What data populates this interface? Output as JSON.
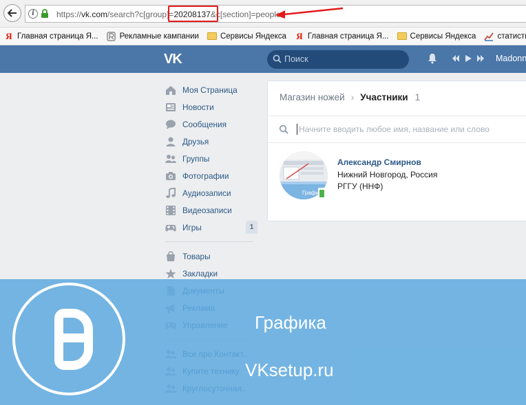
{
  "browser": {
    "url_prefix": "https://",
    "url_domain": "vk.com",
    "url_path_before": "/search?c[group]=",
    "url_highlight": "20208137",
    "url_path_after": "&c[section]=people"
  },
  "bookmarks": [
    {
      "label": "Главная страница Я...",
      "icon": "yandex-icon"
    },
    {
      "label": "Рекламные кампании",
      "icon": "ads-icon"
    },
    {
      "label": "Сервисы Яндекса",
      "icon": "folder-icon"
    },
    {
      "label": "Главная страница Я...",
      "icon": "yandex-icon"
    },
    {
      "label": "Сервисы Яндекса",
      "icon": "folder-icon"
    },
    {
      "label": "статистика сайт",
      "icon": "chart-icon"
    }
  ],
  "header": {
    "logo": "VK",
    "search_placeholder": "Поиск",
    "user_name": "Madonna"
  },
  "sidebar": {
    "items": [
      {
        "label": "Моя Страница",
        "icon": "home-icon"
      },
      {
        "label": "Новости",
        "icon": "news-icon"
      },
      {
        "label": "Сообщения",
        "icon": "messages-icon"
      },
      {
        "label": "Друзья",
        "icon": "friend-icon"
      },
      {
        "label": "Группы",
        "icon": "groups-icon"
      },
      {
        "label": "Фотографии",
        "icon": "camera-icon"
      },
      {
        "label": "Аудиозаписи",
        "icon": "music-icon"
      },
      {
        "label": "Видеозаписи",
        "icon": "video-icon"
      },
      {
        "label": "Игры",
        "icon": "gamepad-icon",
        "badge": "1"
      }
    ],
    "items2": [
      {
        "label": "Товары",
        "icon": "bag-icon"
      },
      {
        "label": "Закладки",
        "icon": "star-icon"
      },
      {
        "label": "Документы",
        "icon": "document-icon"
      },
      {
        "label": "Реклама",
        "icon": "megaphone-icon"
      },
      {
        "label": "Управление",
        "icon": "gamepad-icon"
      }
    ],
    "items3": [
      {
        "label": "Все про Контакт..",
        "icon": "groups-icon"
      },
      {
        "label": "Купите технику",
        "icon": "groups-icon"
      },
      {
        "label": "Круглосуточная..",
        "icon": "groups-icon"
      }
    ]
  },
  "main": {
    "breadcrumb_group": "Магазин ножей",
    "breadcrumb_current": "Участники",
    "member_count": "1",
    "search_placeholder": "Начните вводить любое имя, название или слово",
    "member": {
      "name": "Александр Смирнов",
      "city": "Нижний Новгород, Россия",
      "university": "РГГУ (ННФ)",
      "avatar_caption": "Графика"
    }
  },
  "watermark": {
    "title": "Графика",
    "site": "VKsetup.ru"
  },
  "colors": {
    "vk_blue": "#4a76a8",
    "link": "#2a5885",
    "highlight_red": "#e31b1b",
    "watermark_blue": "#5eaae0"
  }
}
